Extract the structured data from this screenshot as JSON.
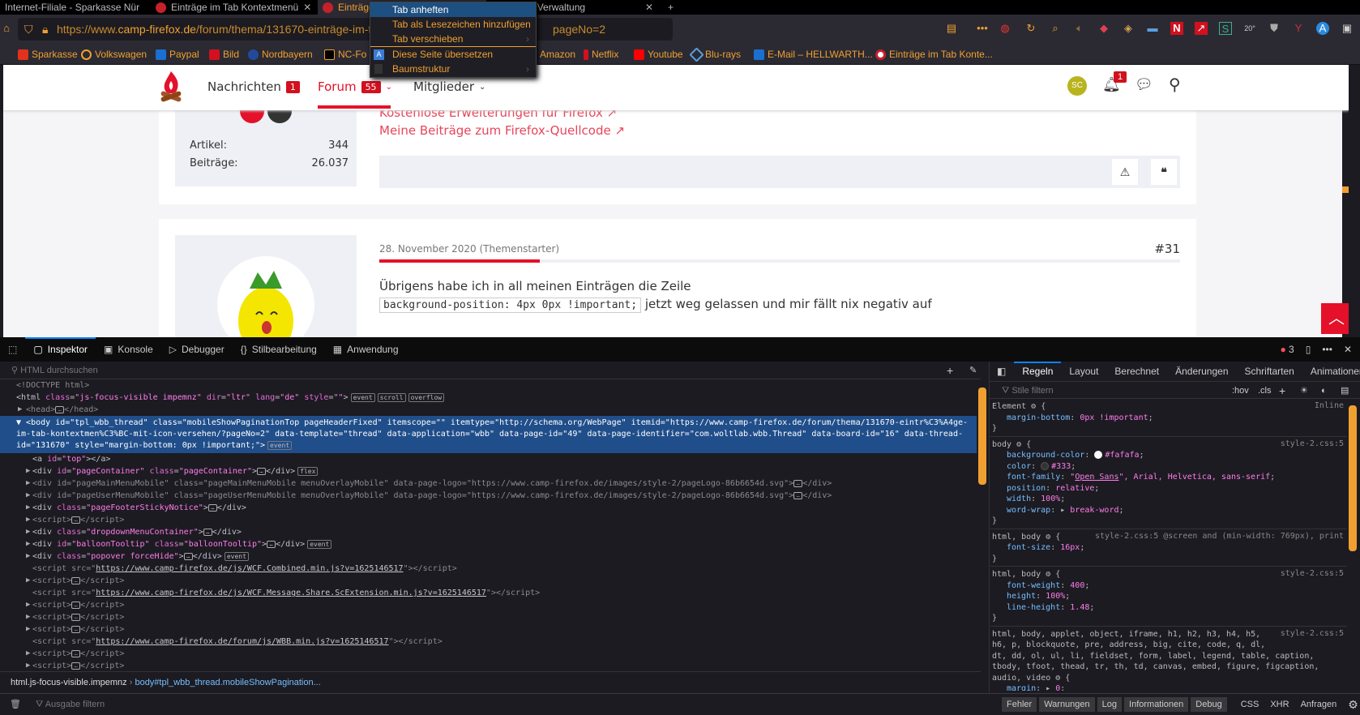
{
  "browser": {
    "tabs": [
      {
        "title": "Internet-Filiale - Sparkasse Nür"
      },
      {
        "title": "Einträge im Tab Kontextmenü"
      },
      {
        "title": "Einträge im Tab Kontextmenü"
      },
      {
        "title": "Buttons-Verwaltung"
      }
    ],
    "url": {
      "prefix": "https://www.",
      "domain": "camp-firefox.de",
      "path": "/forum/thema/131670-einträge-im-tab",
      "tail": "pageNo=2"
    },
    "extension_badge": "20°",
    "bookmarks": [
      "Sparkasse",
      "Volkswagen",
      "Paypal",
      "Bild",
      "Nordbayern",
      "NC-Fo",
      "Amazon",
      "Netflix",
      "Youtube",
      "Blu-rays",
      "E-Mail – HELLWARTH...",
      "Einträge im Tab Konte..."
    ],
    "context_menu": [
      {
        "label": "Tab anheften"
      },
      {
        "label": "Tab als Lesezeichen hinzufügen"
      },
      {
        "label": "Tab verschieben"
      },
      {
        "label": "Diese Seite übersetzen"
      },
      {
        "label": "Baumstruktur"
      }
    ]
  },
  "site": {
    "nav": [
      {
        "label": "Nachrichten",
        "badge": "1"
      },
      {
        "label": "Forum",
        "badge": "55"
      },
      {
        "label": "Mitglieder"
      }
    ],
    "avatar_initials": "SC",
    "notifications": "1",
    "links": [
      "Kostenlose Erweiterungen für Firefox",
      "Meine Beiträge zum Firefox-Quellcode"
    ],
    "stats": [
      {
        "label": "Artikel:",
        "value": "344"
      },
      {
        "label": "Beiträge:",
        "value": "26.037"
      }
    ],
    "post": {
      "date": "28. November 2020 (Themenstarter)",
      "number": "#31",
      "line1": "Übrigens habe ich in all meinen Einträgen die Zeile",
      "code": "background-position: 4px 0px !important;",
      "line2": "jetzt weg gelassen und mir fällt nix negativ auf",
      "progress": 0.2
    }
  },
  "devtools": {
    "tabs": [
      "Inspektor",
      "Konsole",
      "Debugger",
      "Stilbearbeitung",
      "Anwendung"
    ],
    "error_count": "3",
    "search_placeholder": "HTML durchsuchen",
    "breadcrumb": [
      "html.js-focus-visible.impemnz",
      "body#tpl_wbb_thread.mobileShowPagination..."
    ],
    "console_placeholder": "Ausgabe filtern",
    "console_filters": [
      "Fehler",
      "Warnungen",
      "Log",
      "Informationen",
      "Debug"
    ],
    "console_extra": [
      "CSS",
      "XHR",
      "Anfragen"
    ],
    "rule_tabs": [
      "Regeln",
      "Layout",
      "Berechnet",
      "Änderungen",
      "Schriftarten",
      "Animationen"
    ],
    "styles_placeholder": "Stile filtern",
    "hov": ":hov",
    "cls": ".cls"
  }
}
